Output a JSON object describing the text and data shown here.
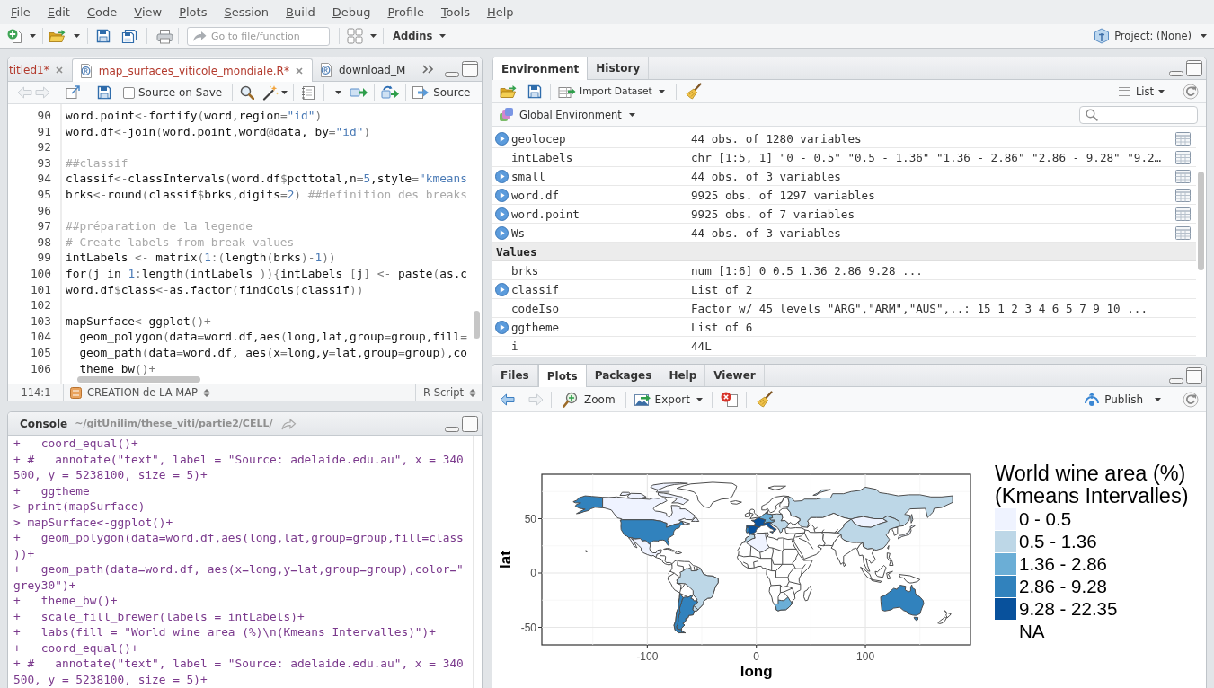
{
  "menu": [
    "File",
    "Edit",
    "Code",
    "View",
    "Plots",
    "Session",
    "Build",
    "Debug",
    "Profile",
    "Tools",
    "Help"
  ],
  "toolbar": {
    "go_to_placeholder": "Go to file/function",
    "addins": "Addins",
    "project": "Project: (None)"
  },
  "editor": {
    "tabs": [
      {
        "label": "titled1*",
        "selected": false,
        "modified": true,
        "close_shown": true
      },
      {
        "label": "map_surfaces_viticole_mondiale.R*",
        "selected": true,
        "modified": true,
        "close_shown": true
      },
      {
        "label": "download_M",
        "selected": false,
        "modified": false,
        "close_shown": false
      }
    ],
    "back_enabled": false,
    "forward_enabled": false,
    "source_on_save": {
      "label": "Source on Save",
      "checked": false
    },
    "source": "Source",
    "lines": [
      {
        "number": "90",
        "code": "word.point<-fortify(word,region=\"id\")"
      },
      {
        "number": "91",
        "code": "word.df<-join(word.point,word@data, by=\"id\")"
      },
      {
        "number": "92"
      },
      {
        "number": "93",
        "code": "##classif"
      },
      {
        "number": "94",
        "code": "classif<-classIntervals(word.df$pcttotal,n=5,style=\"kmeans"
      },
      {
        "number": "95",
        "code": "brks<-round(classif$brks,digits=2) ##definition des breaks"
      },
      {
        "number": "96"
      },
      {
        "number": "97",
        "code": "##préparation de la legende"
      },
      {
        "number": "98",
        "code": "# Create labels from break values"
      },
      {
        "number": "99",
        "code": "intLabels <- matrix(1:(length(brks)-1))"
      },
      {
        "number": "100",
        "code": "for(j in 1:length(intLabels )){intLabels [j] <- paste(as.c"
      },
      {
        "number": "101",
        "code": "word.df$class<-as.factor(findCols(classif))"
      },
      {
        "number": "102"
      },
      {
        "number": "103",
        "code": "mapSurface<-ggplot()+"
      },
      {
        "number": "104",
        "code": "  geom_polygon(data=word.df,aes(long,lat,group=group,fill="
      },
      {
        "number": "105",
        "code": "  geom_path(data=word.df, aes(x=long,y=lat,group=group),co"
      },
      {
        "number": "106",
        "code": "  theme_bw()+"
      }
    ],
    "status": {
      "position": "114:1",
      "section": "CREATION de LA MAP",
      "file_type": "R Script"
    }
  },
  "console": {
    "title": "Console",
    "path": "~/gitUnilim/these_viti/partie2/CELL/",
    "lines": [
      "+   coord_equal()+",
      "+ #   annotate(\"text\", label = \"Source: adelaide.edu.au\", x = 340",
      "500, y = 5238100, size = 5)+",
      "+   ggtheme",
      "> print(mapSurface)",
      "> mapSurface<-ggplot()+",
      "+   geom_polygon(data=word.df,aes(long,lat,group=group,fill=class",
      "))+",
      "+   geom_path(data=word.df, aes(x=long,y=lat,group=group),color=\"",
      "grey30\")+",
      "+   theme_bw()+",
      "+   scale_fill_brewer(labels = intLabels)+",
      "+   labs(fill = \"World wine area (%)\\n(Kmeans Intervalles)\")+",
      "+   coord_equal()+",
      "+ #   annotate(\"text\", label = \"Source: adelaide.edu.au\", x = 340",
      "500, y = 5238100, size = 5)+"
    ]
  },
  "environment": {
    "tabs": [
      {
        "label": "Environment",
        "selected": true
      },
      {
        "label": "History",
        "selected": false
      }
    ],
    "import_dataset": "Import Dataset",
    "view_mode": "List",
    "scope": "Global Environment",
    "rows": [
      {
        "kind": "object",
        "name": "geolocep",
        "value": "44 obs. of 1280 variables",
        "expandable": true,
        "viewable": true
      },
      {
        "kind": "object",
        "name": "intLabels",
        "value": "chr [1:5, 1] \"0 - 0.5\" \"0.5 - 1.36\" \"1.36 - 2.86\" \"2.86 - 9.28\" \"9.2…",
        "expandable": false,
        "viewable": true
      },
      {
        "kind": "object",
        "name": "small",
        "value": "44 obs. of 3 variables",
        "expandable": true,
        "viewable": true
      },
      {
        "kind": "object",
        "name": "word.df",
        "value": "9925 obs. of 1297 variables",
        "expandable": true,
        "viewable": true
      },
      {
        "kind": "object",
        "name": "word.point",
        "value": "9925 obs. of 7 variables",
        "expandable": true,
        "viewable": true
      },
      {
        "kind": "object",
        "name": "Ws",
        "value": "44 obs. of 3 variables",
        "expandable": true,
        "viewable": true
      },
      {
        "kind": "section",
        "title": "Values"
      },
      {
        "kind": "object",
        "name": "brks",
        "value": "num [1:6] 0 0.5 1.36 2.86 9.28 ...",
        "expandable": false,
        "viewable": false
      },
      {
        "kind": "object",
        "name": "classif",
        "value": "List of 2",
        "expandable": true,
        "viewable": false
      },
      {
        "kind": "object",
        "name": "codeIso",
        "value": "Factor w/ 45 levels \"ARG\",\"ARM\",\"AUS\",..: 15 1 2 3 4 6 5 7 9 10 ...",
        "expandable": false,
        "viewable": false
      },
      {
        "kind": "object",
        "name": "ggtheme",
        "value": "List of 6",
        "expandable": true,
        "viewable": false
      },
      {
        "kind": "object",
        "name": "i",
        "value": "44L",
        "expandable": false,
        "viewable": false
      }
    ]
  },
  "plots": {
    "tabs": [
      {
        "label": "Files",
        "selected": false
      },
      {
        "label": "Plots",
        "selected": true
      },
      {
        "label": "Packages",
        "selected": false
      },
      {
        "label": "Help",
        "selected": false
      },
      {
        "label": "Viewer",
        "selected": false
      }
    ],
    "back_enabled": true,
    "forward_enabled": false,
    "zoom": "Zoom",
    "export": "Export",
    "publish": "Publish",
    "plot": {
      "ylabel": "lat",
      "xlabel": "long",
      "yticks": [
        "50",
        "0",
        "-50"
      ],
      "xticks": [
        "-100",
        "0",
        "100"
      ],
      "legend_title": [
        "World wine area (%)",
        "(Kmeans Intervalles)"
      ],
      "legend": [
        {
          "label": "0 - 0.5",
          "color": "#eff3ff"
        },
        {
          "label": "0.5 - 1.36",
          "color": "#bdd7e7"
        },
        {
          "label": "1.36 - 2.86",
          "color": "#6baed6"
        },
        {
          "label": "2.86 - 9.28",
          "color": "#3182bd"
        },
        {
          "label": "9.28 - 22.35",
          "color": "#08519c"
        },
        {
          "label": "NA"
        }
      ]
    }
  }
}
